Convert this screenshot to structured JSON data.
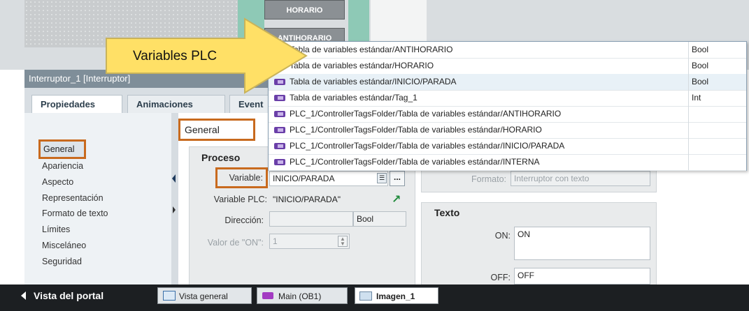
{
  "canvas": {
    "btn_horario": "HORARIO",
    "btn_antihorario": "ANTIHORARIO"
  },
  "callout": {
    "text": "Variables PLC"
  },
  "object_title": "Interruptor_1 [Interruptor]",
  "tabs": {
    "propiedades": "Propiedades",
    "animaciones": "Animaciones",
    "eventos": "Event"
  },
  "left_nav": {
    "general": "General",
    "items": [
      "Apariencia",
      "Aspecto",
      "Representación",
      "Formato de texto",
      "Límites",
      "Misceláneo",
      "Seguridad"
    ]
  },
  "general_header": "General",
  "proceso": {
    "title": "Proceso",
    "variable_label": "Variable:",
    "variable_value": "INICIO/PARADA",
    "variable_plc_label": "Variable PLC:",
    "variable_plc_value": "\"INICIO/PARADA\"",
    "direccion_label": "Dirección:",
    "direccion_type": "Bool",
    "valor_on_label": "Valor de \"ON\":",
    "valor_on_value": "1"
  },
  "formato": {
    "label": "Formato:",
    "value": "Interruptor con texto"
  },
  "texto": {
    "title": "Texto",
    "on_label": "ON:",
    "on_value": "ON",
    "off_label": "OFF:",
    "off_value": "OFF"
  },
  "dropdown": {
    "rows": [
      {
        "name": "Tabla de variables estándar/ANTIHORARIO",
        "type": "Bool"
      },
      {
        "name": "Tabla de variables estándar/HORARIO",
        "type": "Bool"
      },
      {
        "name": "Tabla de variables estándar/INICIO/PARADA",
        "type": "Bool"
      },
      {
        "name": "Tabla de variables estándar/Tag_1",
        "type": "Int"
      },
      {
        "name": "PLC_1/ControllerTagsFolder/Tabla de variables estándar/ANTIHORARIO",
        "type": ""
      },
      {
        "name": "PLC_1/ControllerTagsFolder/Tabla de variables estándar/HORARIO",
        "type": ""
      },
      {
        "name": "PLC_1/ControllerTagsFolder/Tabla de variables estándar/INICIO/PARADA",
        "type": ""
      },
      {
        "name": "PLC_1/ControllerTagsFolder/Tabla de variables estándar/INTERNA",
        "type": ""
      }
    ]
  },
  "bottom_bar": {
    "portal": "Vista del portal",
    "tab_overview": "Vista general",
    "tab_main": "Main (OB1)",
    "tab_imagen": "Imagen_1"
  },
  "colors": {
    "highlight": "#c86a1e",
    "arrow": "#ffe066",
    "tag_icon": "#6a3fa8"
  }
}
